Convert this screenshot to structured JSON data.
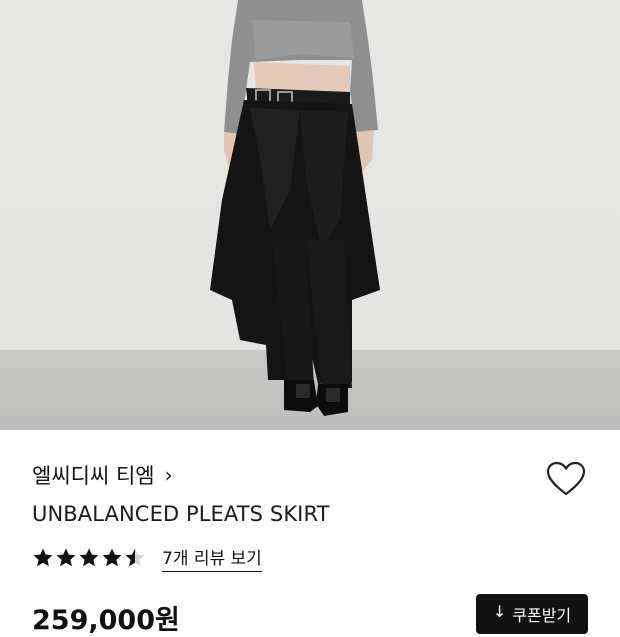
{
  "brand": {
    "name": "엘씨디씨 티엠",
    "chevron": "›"
  },
  "product": {
    "name": "UNBALANCED PLEATS SKIRT"
  },
  "rating": {
    "value": 4.5,
    "max": 5,
    "review_link": "7개 리뷰 보기"
  },
  "price": {
    "text": "259,000원"
  },
  "coupon": {
    "icon": "↓",
    "label": "쿠폰받기"
  },
  "icons": {
    "wishlist": "heart-outline-icon",
    "star": "star-icon"
  },
  "colors": {
    "accent": "#111111",
    "star": "#111111",
    "background": "#ffffff"
  }
}
